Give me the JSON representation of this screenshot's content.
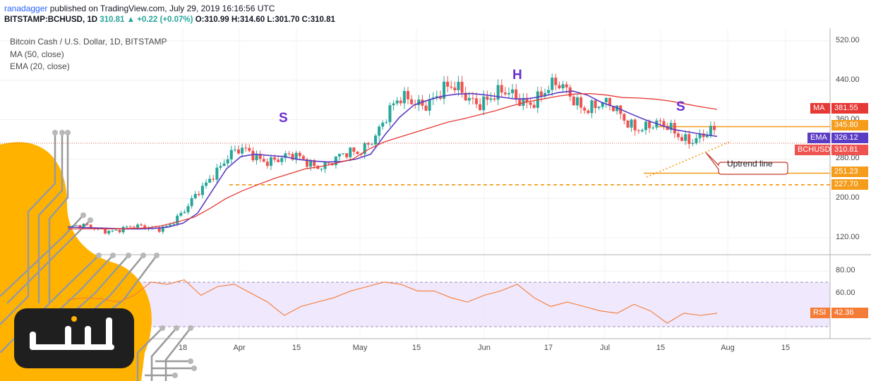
{
  "header": {
    "user": "ranadagger",
    "published": " published on TradingView.com, July 29, 2019 16:16:56 UTC",
    "symbol": "BITSTAMP:BCHUSD, 1D",
    "change": "310.81 ▲ +0.22 (+0.07%)",
    "ohlc": "O:310.99 H:314.60 L:301.70 C:310.81"
  },
  "legend": {
    "title": "Bitcoin Cash / U.S. Dollar, 1D, BITSTAMP",
    "ma": "MA (50, close)",
    "ema": "EMA (20, close)"
  },
  "annotations": {
    "s_left": "S",
    "head": "H",
    "s_right": "S",
    "uptrend": "Uptrend line"
  },
  "price_tags": {
    "ma_label": "MA",
    "ma_value": "381.55",
    "level_345": "345.80",
    "ema_label": "EMA",
    "ema_value": "326.12",
    "sym_label": "BCHUSD",
    "sym_value": "310.81",
    "level_251": "251.23",
    "level_227": "227.70",
    "rsi_label": "RSI",
    "rsi_value": "42.36"
  },
  "colors": {
    "up": "#26a69a",
    "down": "#ef5350",
    "ema": "#5b3cc4",
    "ma": "#e53935",
    "level": "#f59c1a",
    "rsi": "#f57c36",
    "rsi_band": "#e8e0f8"
  },
  "chart_data": {
    "type": "line",
    "title": "Bitcoin Cash / U.S. Dollar, 1D, BITSTAMP",
    "price_axis": {
      "ticks": [
        520,
        440,
        360,
        280,
        200,
        120
      ],
      "ylim": [
        100,
        540
      ]
    },
    "rsi_axis": {
      "ticks": [
        80,
        60,
        40
      ],
      "ylim": [
        20,
        100
      ],
      "band": [
        30,
        70
      ]
    },
    "x_ticks": [
      "18",
      "Apr",
      "15",
      "May",
      "15",
      "Jun",
      "17",
      "Jul",
      "15",
      "Aug",
      "15"
    ],
    "levels": [
      345.8,
      251.23,
      227.7
    ],
    "current_price": 310.81,
    "series": [
      {
        "name": "EMA (20, close)",
        "last": 326.12,
        "values": [
          142,
          141,
          140,
          139,
          138,
          138,
          139,
          142,
          150,
          170,
          215,
          260,
          285,
          290,
          287,
          285,
          279,
          276,
          274,
          275,
          280,
          290,
          330,
          365,
          390,
          400,
          408,
          412,
          413,
          410,
          406,
          402,
          403,
          408,
          415,
          418,
          410,
          395,
          385,
          372,
          360,
          350,
          340,
          335,
          330,
          326
        ]
      },
      {
        "name": "MA (50, close)",
        "last": 381.55,
        "values": [
          138,
          138,
          138,
          138,
          139,
          140,
          145,
          153,
          162,
          180,
          200,
          215,
          228,
          240,
          250,
          260,
          265,
          272,
          280,
          300,
          315,
          325,
          335,
          345,
          355,
          362,
          370,
          378,
          388,
          396,
          402,
          408,
          412,
          413,
          410,
          405,
          404,
          402,
          398,
          392,
          386,
          381
        ]
      },
      {
        "name": "RSI",
        "last": 42.36,
        "values": [
          54,
          56,
          55,
          52,
          58,
          70,
          68,
          72,
          58,
          66,
          68,
          60,
          52,
          40,
          48,
          52,
          56,
          62,
          66,
          70,
          68,
          62,
          62,
          56,
          52,
          58,
          62,
          68,
          56,
          48,
          52,
          48,
          44,
          42,
          50,
          44,
          33,
          42,
          40,
          42
        ]
      }
    ]
  }
}
